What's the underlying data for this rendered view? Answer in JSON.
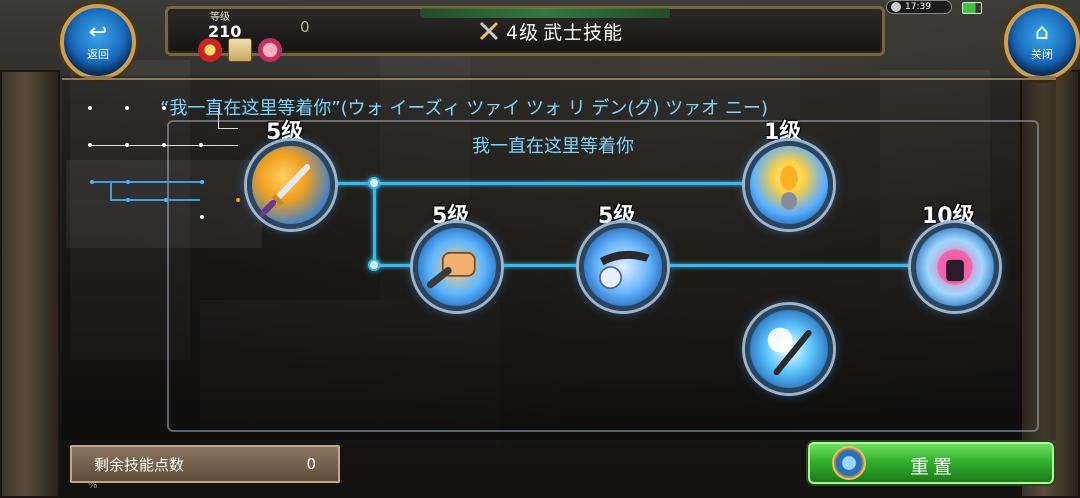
{
  "header": {
    "level_label": "等级",
    "level_value": "210",
    "top_counter": "0",
    "title_level": "4级",
    "title_text": "武士技能",
    "clock": "17:39"
  },
  "nav": {
    "back_label": "返回",
    "close_label": "关闭"
  },
  "skill_info": {
    "name_full": "“我一直在这里等着你”(ウォ イーズィ ツァイ ツォ リ デン(グ) ツァオ ニー)",
    "name_short": "我一直在这里等着你"
  },
  "skills": [
    {
      "level": "5级",
      "icon": "sword-icon"
    },
    {
      "level": "5级",
      "icon": "fist-icon"
    },
    {
      "level": "5级",
      "icon": "blade-slash-icon"
    },
    {
      "level": "1级",
      "icon": "aura-warrior-icon"
    },
    {
      "level": "10级",
      "icon": "pink-aura-warrior-icon"
    },
    {
      "level": "",
      "icon": "lightning-strike-icon"
    }
  ],
  "footer": {
    "points_label": "剩余技能点数",
    "points_value": "0",
    "reset_label": "重置",
    "bottom_pct": "%"
  },
  "colors": {
    "accent_blue": "#38b9ee",
    "skill_name_text": "#7fd4ff",
    "reset_green": "#33b02e",
    "frame_gold": "#c9a054"
  }
}
